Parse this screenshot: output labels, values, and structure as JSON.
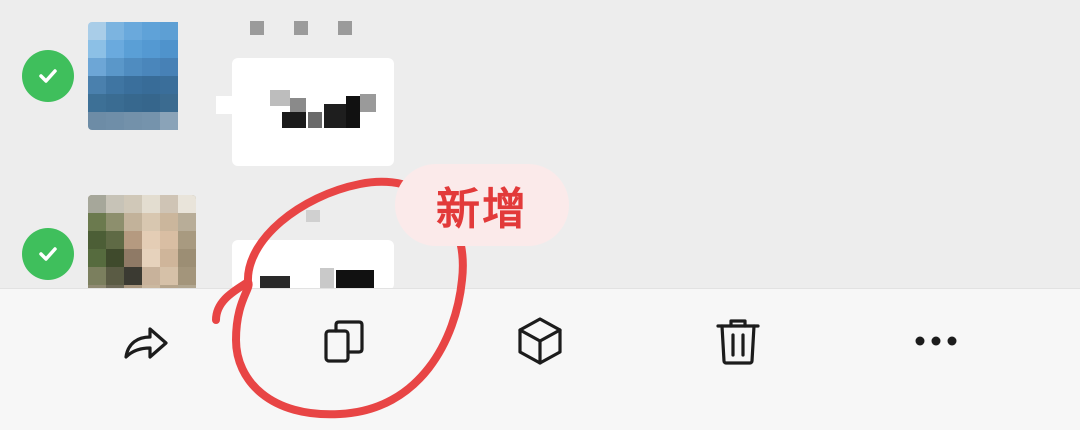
{
  "badge": {
    "text": "新增"
  },
  "toolbar": {
    "buttons": [
      {
        "icon": "forward-icon"
      },
      {
        "icon": "copy-icon"
      },
      {
        "icon": "cube-icon"
      },
      {
        "icon": "trash-icon"
      },
      {
        "icon": "more-icon"
      }
    ]
  },
  "colors": {
    "background": "#ededed",
    "toolbar": "#f7f7f7",
    "check": "#3fbf5c",
    "annotation": "#e84545",
    "badge_bg": "#fbeaea"
  }
}
